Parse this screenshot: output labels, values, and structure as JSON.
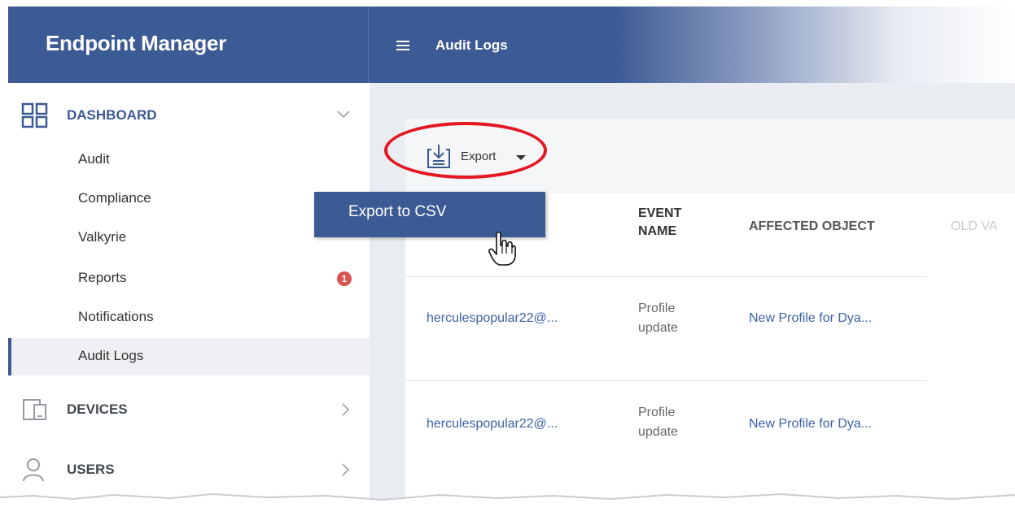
{
  "app": {
    "title": "Endpoint Manager"
  },
  "topbar": {
    "title": "Audit Logs"
  },
  "sidebar": {
    "sections": [
      {
        "label": "DASHBOARD",
        "icon": "dashboard-grid-icon",
        "chevron": "chevron-down-icon"
      },
      {
        "label": "DEVICES",
        "icon": "devices-icon",
        "chevron": "chevron-right-icon"
      },
      {
        "label": "USERS",
        "icon": "user-icon",
        "chevron": "chevron-right-icon"
      }
    ],
    "items": [
      {
        "label": "Audit"
      },
      {
        "label": "Compliance"
      },
      {
        "label": "Valkyrie"
      },
      {
        "label": "Reports",
        "badge": "1"
      },
      {
        "label": "Notifications"
      },
      {
        "label": "Audit Logs",
        "active": true
      }
    ]
  },
  "toolbar": {
    "export_label": "Export"
  },
  "dropdown": {
    "items": [
      {
        "label": "Export to CSV"
      }
    ]
  },
  "table": {
    "columns": [
      {
        "label": "EVENT\nNAME"
      },
      {
        "label": "AFFECTED OBJECT"
      },
      {
        "label": "OLD VA"
      }
    ],
    "rows": [
      {
        "user": "herculespopular22@...",
        "event": "Profile\nupdate",
        "object": "New Profile for Dya..."
      },
      {
        "user": "herculespopular22@...",
        "event": "Profile\nupdate",
        "object": "New Profile for Dya..."
      }
    ]
  },
  "colors": {
    "brand": "#3c5a94",
    "highlight_ring": "#e3171f",
    "badge": "#d9534f",
    "link": "#3a63a8"
  }
}
